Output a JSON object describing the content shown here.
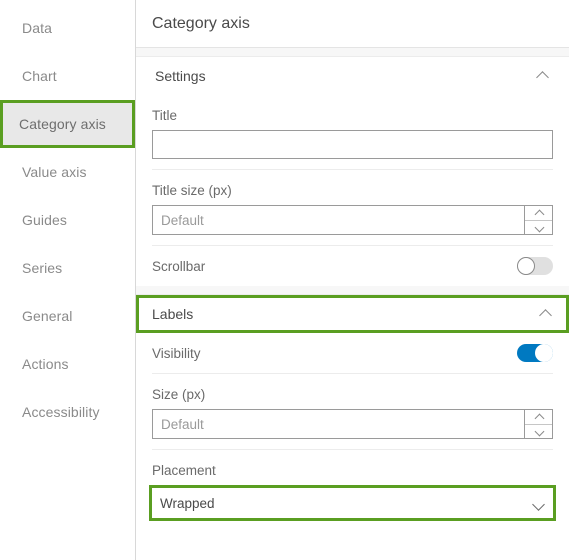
{
  "sidebar": {
    "items": [
      {
        "label": "Data",
        "selected": false
      },
      {
        "label": "Chart",
        "selected": false
      },
      {
        "label": "Category axis",
        "selected": true
      },
      {
        "label": "Value axis",
        "selected": false
      },
      {
        "label": "Guides",
        "selected": false
      },
      {
        "label": "Series",
        "selected": false
      },
      {
        "label": "General",
        "selected": false
      },
      {
        "label": "Actions",
        "selected": false
      },
      {
        "label": "Accessibility",
        "selected": false
      }
    ]
  },
  "panel": {
    "title": "Category axis",
    "settings": {
      "heading": "Settings",
      "collapse_icon": "chevron-up-icon",
      "title_label": "Title",
      "title_value": "",
      "title_placeholder": "",
      "title_size_label": "Title size (px)",
      "title_size_value": "",
      "title_size_placeholder": "Default",
      "scrollbar_label": "Scrollbar",
      "scrollbar_on": false
    },
    "labels": {
      "heading": "Labels",
      "collapse_icon": "chevron-up-icon",
      "highlighted": true,
      "visibility_label": "Visibility",
      "visibility_on": true,
      "size_label": "Size (px)",
      "size_value": "",
      "size_placeholder": "Default",
      "placement_label": "Placement",
      "placement_value": "Wrapped",
      "placement_highlighted": true
    }
  },
  "colors": {
    "highlight_green": "#5a9e21",
    "toggle_on_blue": "#0079c1",
    "selected_bg": "#e8e8e8"
  }
}
